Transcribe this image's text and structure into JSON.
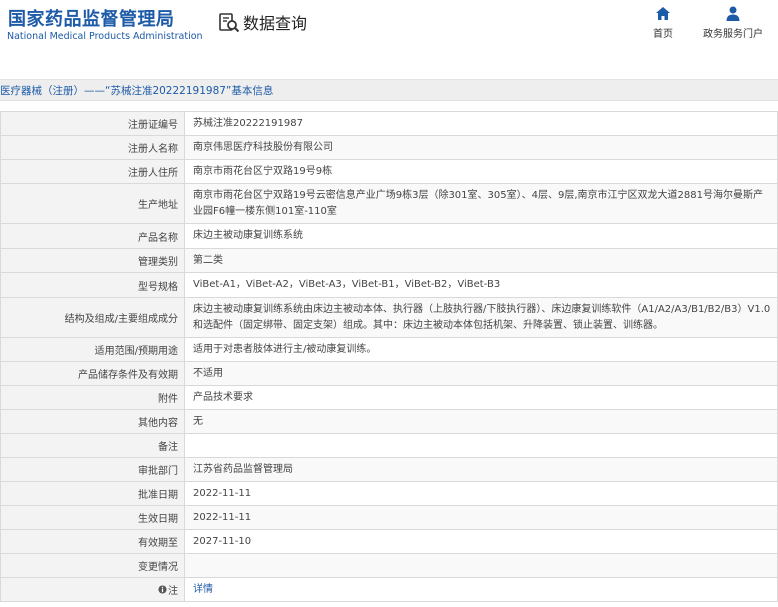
{
  "header": {
    "logo_cn": "国家药品监督管理局",
    "logo_en": "National Medical Products Administration",
    "section_title": "数据查询",
    "nav": [
      {
        "label": "首页",
        "icon": "home-icon"
      },
      {
        "label": "政务服务门户",
        "icon": "user-icon"
      }
    ]
  },
  "title_bar": "医疗器械（注册）——“苏械注准20222191987”基本信息",
  "colors": {
    "brand": "#1d5aa7",
    "key_bg": "#f3f3f3",
    "border": "#d9d9d9"
  },
  "rows": [
    {
      "key": "注册证编号",
      "value": "苏械注准20222191987"
    },
    {
      "key": "注册人名称",
      "value": "南京伟思医疗科技股份有限公司"
    },
    {
      "key": "注册人住所",
      "value": "南京市雨花台区宁双路19号9栋"
    },
    {
      "key": "生产地址",
      "value": "南京市雨花台区宁双路19号云密信息产业广场9栋3层（除301室、305室）、4层、9层,南京市江宁区双龙大道2881号海尔曼斯产业园F6幢一楼东侧101室-110室"
    },
    {
      "key": "产品名称",
      "value": "床边主被动康复训练系统"
    },
    {
      "key": "管理类别",
      "value": "第二类"
    },
    {
      "key": "型号规格",
      "value": "ViBet-A1，ViBet-A2，ViBet-A3，ViBet-B1，ViBet-B2，ViBet-B3"
    },
    {
      "key": "结构及组成/主要组成成分",
      "value": "床边主被动康复训练系统由床边主被动本体、执行器（上肢执行器/下肢执行器）、床边康复训练软件（A1/A2/A3/B1/B2/B3）V1.0和选配件（固定绑带、固定支架）组成。其中：床边主被动本体包括机架、升降装置、锁止装置、训练器。"
    },
    {
      "key": "适用范围/预期用途",
      "value": "适用于对患者肢体进行主/被动康复训练。"
    },
    {
      "key": "产品储存条件及有效期",
      "value": "不适用"
    },
    {
      "key": "附件",
      "value": "产品技术要求"
    },
    {
      "key": "其他内容",
      "value": "无"
    },
    {
      "key": "备注",
      "value": ""
    },
    {
      "key": "审批部门",
      "value": "江苏省药品监督管理局"
    },
    {
      "key": "批准日期",
      "value": "2022-11-11"
    },
    {
      "key": "生效日期",
      "value": "2022-11-11"
    },
    {
      "key": "有效期至",
      "value": "2027-11-10"
    },
    {
      "key": "变更情况",
      "value": ""
    },
    {
      "key": "注",
      "value": "详情",
      "key_icon": "info-icon"
    }
  ]
}
